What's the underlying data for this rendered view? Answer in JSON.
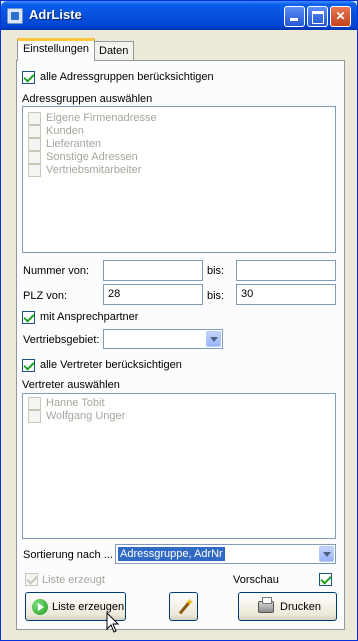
{
  "window": {
    "title": "AdrListe",
    "controls": {
      "minimize": "",
      "maximize": "",
      "close": "✕"
    }
  },
  "tabs": [
    {
      "label": "Einstellungen",
      "active": true
    },
    {
      "label": "Daten",
      "active": false
    }
  ],
  "address_groups": {
    "all_checkbox_label": "alle Adressgruppen berücksichtigen",
    "all_checked": true,
    "select_label": "Adressgruppen auswählen",
    "items": [
      {
        "label": "Eigene Firmenadresse",
        "checked": false
      },
      {
        "label": "Kunden",
        "checked": false
      },
      {
        "label": "Lieferanten",
        "checked": false
      },
      {
        "label": "Sonstige Adressen",
        "checked": false
      },
      {
        "label": "Vertriebsmitarbeiter",
        "checked": false
      }
    ]
  },
  "range": {
    "nummer_label": "Nummer von:",
    "nummer_from": "",
    "nummer_to": "",
    "plz_label": "PLZ von:",
    "plz_from": "28",
    "plz_to": "30",
    "bis_label": "bis:"
  },
  "contact": {
    "label": "mit Ansprechpartner",
    "checked": true
  },
  "sales_area": {
    "label": "Vertriebsgebiet:",
    "value": ""
  },
  "reps": {
    "all_checkbox_label": "alle Vertreter berücksichtigen",
    "all_checked": true,
    "select_label": "Vertreter auswählen",
    "items": [
      {
        "label": "Hanne Tobit",
        "checked": false
      },
      {
        "label": "Wolfgang Unger",
        "checked": false
      }
    ]
  },
  "sort": {
    "label": "Sortierung nach ...",
    "value": "Adressgruppe, AdrNr"
  },
  "footer": {
    "list_created_label": "Liste erzeugt",
    "list_created_checked": true,
    "preview_label": "Vorschau",
    "preview_checked": true,
    "create_button": "Liste erzeugen",
    "print_button": "Drucken"
  },
  "colors": {
    "titlebar": "#0550dc",
    "tab_highlight": "#ffc73c",
    "selection": "#316ac5"
  }
}
